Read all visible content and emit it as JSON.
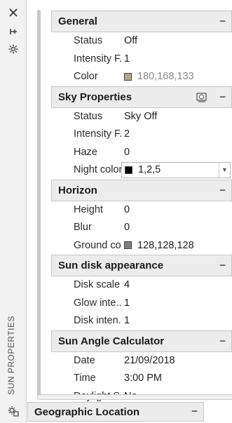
{
  "strip": {
    "title": "SUN PROPERTIES",
    "icons": [
      "close-icon",
      "pin-icon",
      "settings-icon",
      "sun-icon"
    ]
  },
  "sections": [
    {
      "title": "General",
      "rows": [
        {
          "label": "Status",
          "value": "Off"
        },
        {
          "label": "Intensity F...",
          "value": "1"
        },
        {
          "label": "Color",
          "value": "180,168,133",
          "swatch": "#b4a885",
          "muted": true
        }
      ]
    },
    {
      "title": "Sky Properties",
      "rows": [
        {
          "label": "Status",
          "value": "Sky Off"
        },
        {
          "label": "Intensity F...",
          "value": "2"
        },
        {
          "label": "Haze",
          "value": "0"
        },
        {
          "label": "Night color",
          "value": "1,2,5",
          "swatch": "#010205",
          "editing": true
        }
      ]
    },
    {
      "title": "Horizon",
      "rows": [
        {
          "label": "Height",
          "value": "0"
        },
        {
          "label": "Blur",
          "value": "0"
        },
        {
          "label": "Ground co...",
          "value": "128,128,128",
          "swatch": "#808080"
        }
      ]
    },
    {
      "title": "Sun disk appearance",
      "rows": [
        {
          "label": "Disk scale",
          "value": "4"
        },
        {
          "label": "Glow inte...",
          "value": "1"
        },
        {
          "label": "Disk inten...",
          "value": "1"
        }
      ]
    },
    {
      "title": "Sun Angle Calculator",
      "rows": [
        {
          "label": "Date",
          "value": "21/09/2018"
        },
        {
          "label": "Time",
          "value": "3:00 PM"
        },
        {
          "label": "Daylight S...",
          "value": "No"
        }
      ]
    }
  ],
  "geo": {
    "title": "Geographic Location"
  },
  "collapse_symbol": "−"
}
